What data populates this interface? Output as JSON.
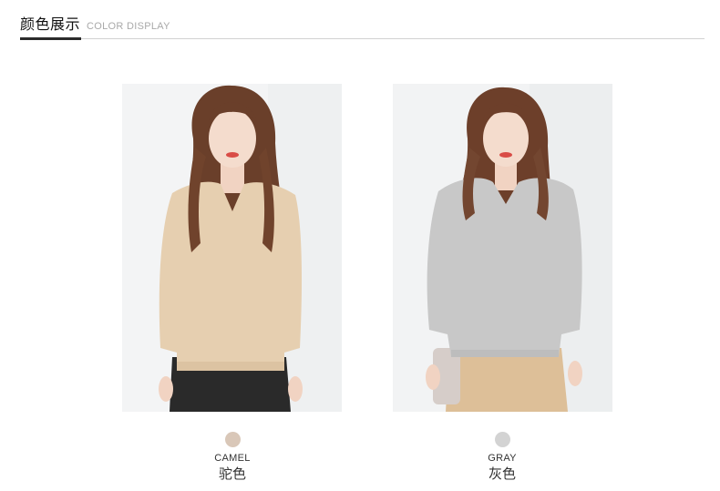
{
  "header": {
    "title": "颜色展示",
    "subtitle": "COLOR DISPLAY"
  },
  "colors": [
    {
      "name_en": "CAMEL",
      "name_cn": "驼色",
      "swatch": "#d9c7b8",
      "sweater": "#e6cfb0"
    },
    {
      "name_en": "GRAY",
      "name_cn": "灰色",
      "swatch": "#d3d3d3",
      "sweater": "#c8c8c8"
    }
  ]
}
